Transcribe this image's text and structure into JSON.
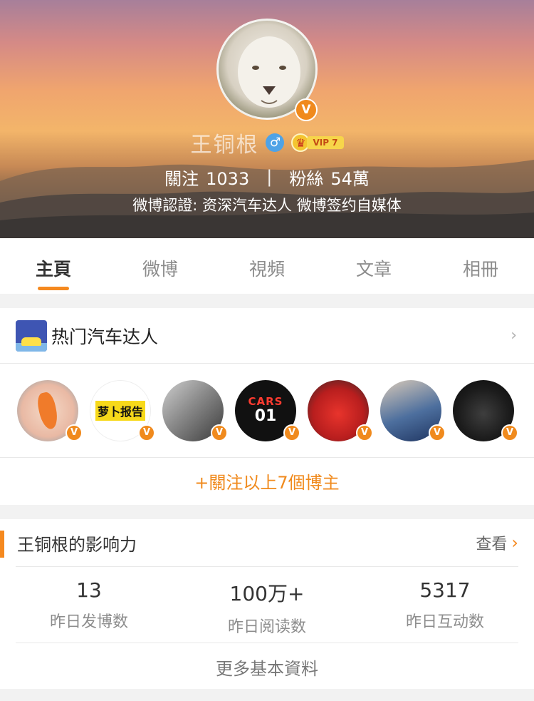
{
  "profile": {
    "name": "王铜根",
    "gender_symbol": "♂",
    "vip_label": "VIP 7",
    "verified_badge": "V",
    "following_label": "關注",
    "following_count": "1033",
    "separator": "|",
    "followers_label": "粉絲",
    "followers_count": "54萬",
    "verification": "微博認證: 资深汽车达人 微博签约自媒体"
  },
  "tabs": [
    {
      "label": "主頁",
      "active": true
    },
    {
      "label": "微博",
      "active": false
    },
    {
      "label": "視頻",
      "active": false
    },
    {
      "label": "文章",
      "active": false
    },
    {
      "label": "相冊",
      "active": false
    }
  ],
  "hot_section": {
    "title": "热门汽车达人",
    "chevron": "›",
    "bloggers": [
      {
        "icon": "carrot-avatar"
      },
      {
        "icon": "luobo-report-logo-avatar",
        "text": "萝卜报告"
      },
      {
        "icon": "car-interior-avatar"
      },
      {
        "icon": "cars01-logo-avatar",
        "text_top": "CARS",
        "text_bottom": "01"
      },
      {
        "icon": "red-sportscar-avatar"
      },
      {
        "icon": "person-with-car-avatar"
      },
      {
        "icon": "black-racecar-avatar"
      }
    ],
    "follow_all_label": "+關注以上7個博主"
  },
  "influence": {
    "title": "王铜根的影响力",
    "link_label": "查看",
    "link_arrow": "›",
    "stats": [
      {
        "value": "13",
        "label": "昨日发博数"
      },
      {
        "value": "100万+",
        "label": "昨日阅读数"
      },
      {
        "value": "5317",
        "label": "昨日互动数"
      }
    ],
    "more_label": "更多基本資料"
  },
  "colors": {
    "accent": "#f5891f",
    "badge_orange": "#f08a1d",
    "gender_blue": "#4fa3e6"
  }
}
